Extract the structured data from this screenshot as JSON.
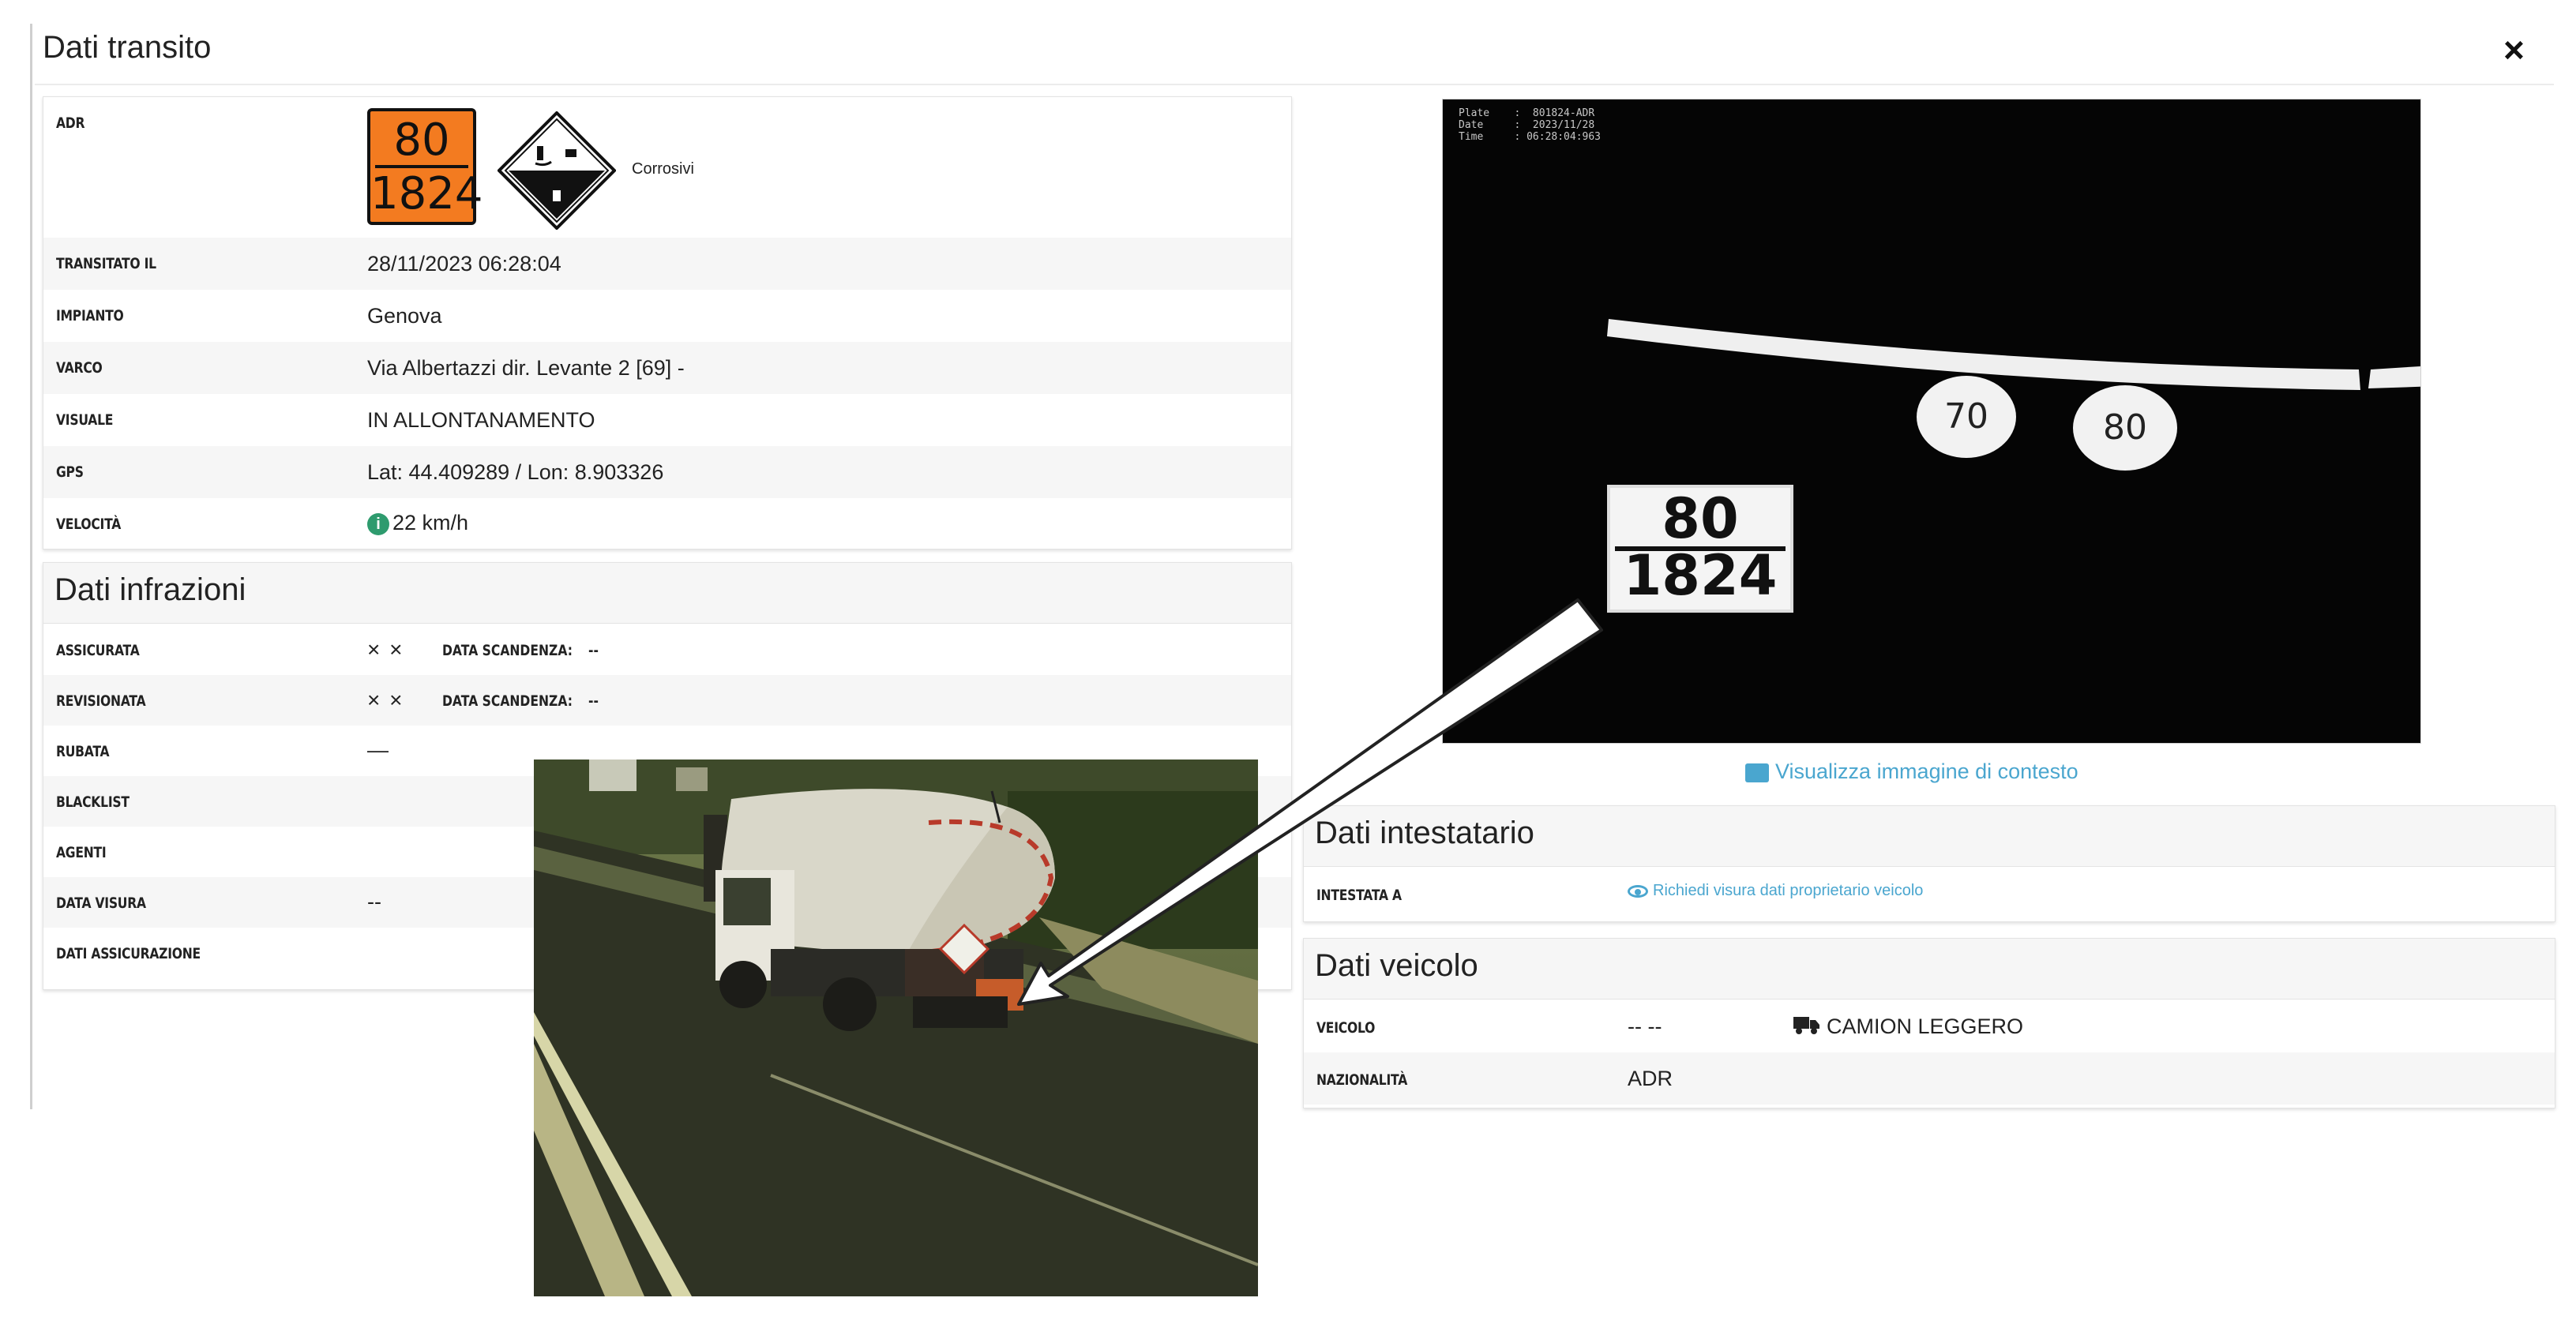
{
  "modal": {
    "title": "Dati transito",
    "close_label": "×"
  },
  "adr": {
    "label": "ADR",
    "plate_top": "80",
    "plate_bottom": "1824",
    "hazard_text": "Corrosivi",
    "plate_color": "#f37b20"
  },
  "transit_rows": [
    {
      "label": "TRANSITATO IL",
      "value": "28/11/2023 06:28:04"
    },
    {
      "label": "IMPIANTO",
      "value": "Genova"
    },
    {
      "label": "VARCO",
      "value": "Via Albertazzi dir. Levante 2 [69] -"
    },
    {
      "label": "VISUALE",
      "value": "IN ALLONTANAMENTO"
    },
    {
      "label": "GPS",
      "value": "Lat: 44.409289 / Lon: 8.903326"
    },
    {
      "label": "VELOCITÀ",
      "value": "22 km/h",
      "icon": "info-icon"
    }
  ],
  "infrazioni": {
    "title": "Dati infrazioni",
    "rows": [
      {
        "label": "ASSICURATA",
        "marks": "× ×",
        "sub_label": "DATA SCANDENZA:",
        "sub_value": "--"
      },
      {
        "label": "REVISIONATA",
        "marks": "× ×",
        "sub_label": "DATA SCANDENZA:",
        "sub_value": "--"
      },
      {
        "label": "RUBATA",
        "value": "—"
      },
      {
        "label": "BLACKLIST",
        "value": ""
      },
      {
        "label": "AGENTI",
        "value": ""
      },
      {
        "label": "DATA VISURA",
        "value": "--"
      },
      {
        "label": "DATI ASSICURAZIONE",
        "value": ""
      }
    ]
  },
  "camera": {
    "meta": "Plate    :  801824-ADR\nDate     :  2023/11/28\nTime     : 06:28:04:963",
    "sign1": "70",
    "sign2": "80",
    "plate_top": "80",
    "plate_bottom": "1824",
    "context_link": "Visualizza immagine di contesto"
  },
  "intestatario": {
    "title": "Dati intestatario",
    "label": "INTESTATA A",
    "link": "Richiedi visura dati proprietario veicolo"
  },
  "veicolo": {
    "title": "Dati veicolo",
    "rows": [
      {
        "label": "VEICOLO",
        "value": "-- --",
        "type": "CAMION LEGGERO",
        "icon": "truck-icon"
      },
      {
        "label": "NAZIONALITÀ",
        "value": "ADR"
      }
    ]
  },
  "colors": {
    "link": "#4aa6cf",
    "info_green": "#2e9b6e"
  }
}
